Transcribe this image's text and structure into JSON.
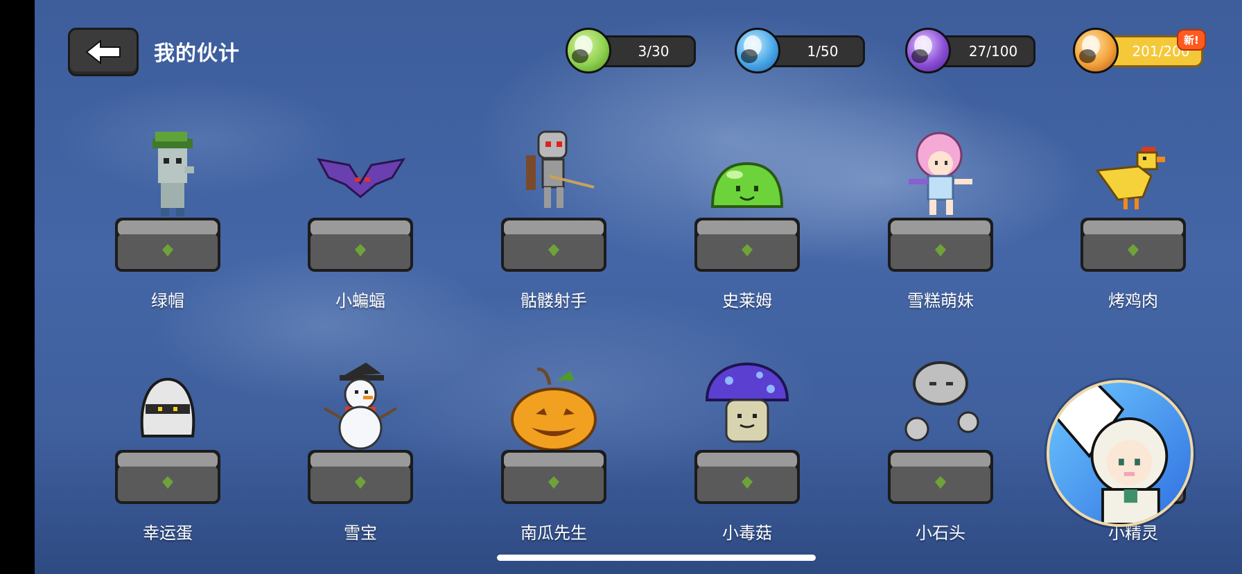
{
  "header": {
    "title": "我的伙计"
  },
  "currencies": [
    {
      "id": "green",
      "value": "3/30",
      "color": "#8fd14f",
      "icon": "green-orb-icon"
    },
    {
      "id": "blue",
      "value": "1/50",
      "color": "#4aa8e8",
      "icon": "blue-orb-icon"
    },
    {
      "id": "purple",
      "value": "27/100",
      "color": "#8b4fd6",
      "icon": "purple-orb-icon"
    },
    {
      "id": "gold",
      "value": "201/200",
      "color": "#f3a23a",
      "icon": "gold-orb-icon"
    }
  ],
  "new_badge": "新!",
  "companions": [
    {
      "name": "绿帽",
      "icon": "zombie-green-hat-icon"
    },
    {
      "name": "小蝙蝠",
      "icon": "bat-icon"
    },
    {
      "name": "骷髅射手",
      "icon": "skeleton-archer-icon"
    },
    {
      "name": "史莱姆",
      "icon": "slime-icon"
    },
    {
      "name": "雪糕萌妹",
      "icon": "ice-cream-girl-icon"
    },
    {
      "name": "烤鸡肉",
      "icon": "chicken-icon"
    },
    {
      "name": "幸运蛋",
      "icon": "lucky-egg-icon"
    },
    {
      "name": "雪宝",
      "icon": "snowman-icon"
    },
    {
      "name": "南瓜先生",
      "icon": "pumpkin-icon"
    },
    {
      "name": "小毒菇",
      "icon": "poison-mushroom-icon"
    },
    {
      "name": "小石头",
      "icon": "rock-golem-icon"
    },
    {
      "name": "小精灵",
      "icon": "little-elf-icon"
    }
  ],
  "colors": {
    "pedestal": "#5a5a5a",
    "pedestal_top": "#9a9a9a",
    "gem": "#6fa33a"
  }
}
